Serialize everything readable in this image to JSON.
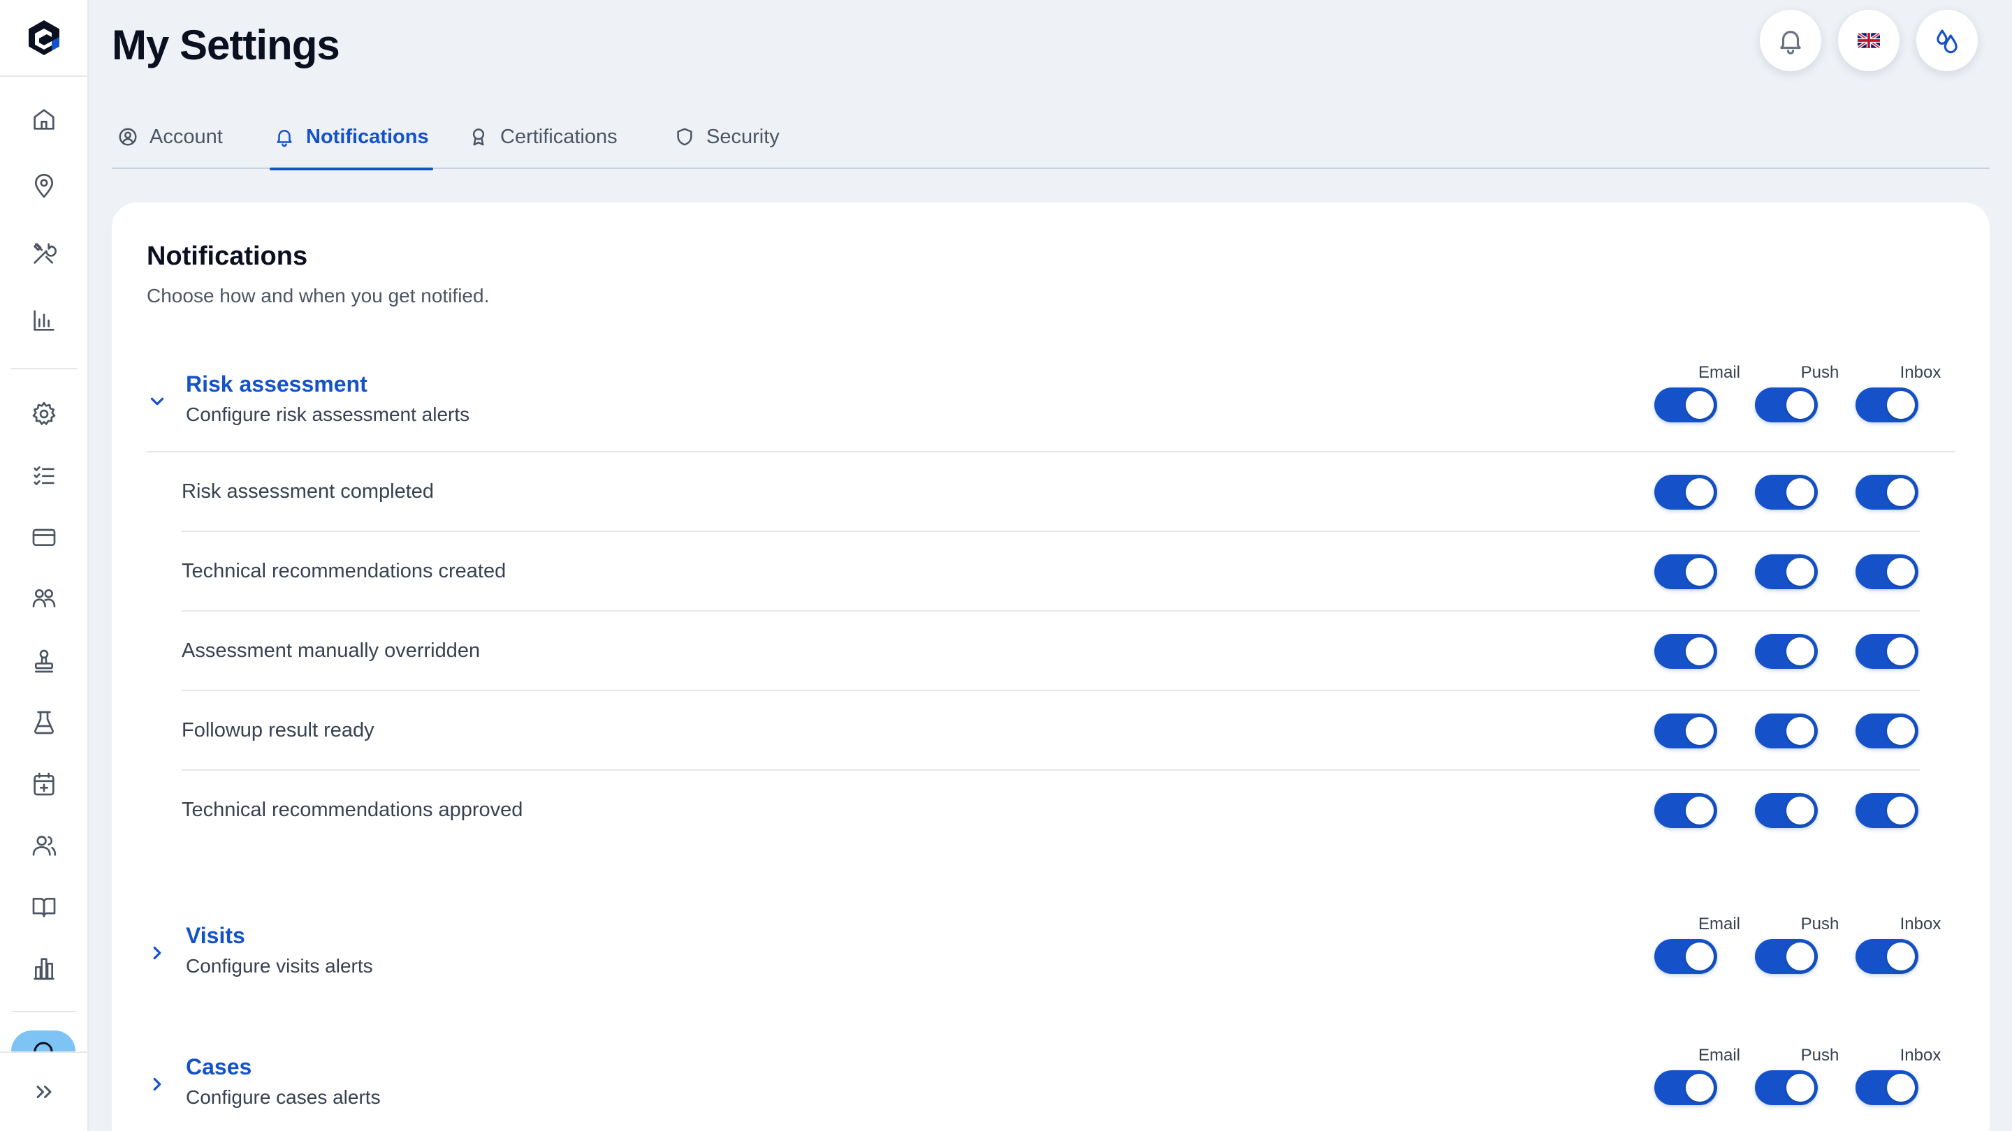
{
  "header": {
    "title": "My Settings"
  },
  "tabs": [
    {
      "label": "Account",
      "icon": "user-circle-icon",
      "active": false
    },
    {
      "label": "Notifications",
      "icon": "bell-icon",
      "active": true
    },
    {
      "label": "Certifications",
      "icon": "award-icon",
      "active": false
    },
    {
      "label": "Security",
      "icon": "shield-icon",
      "active": false
    }
  ],
  "sidebar": {
    "items": [
      "home-icon",
      "map-pin-icon",
      "tools-icon",
      "bar-chart-icon",
      "gear-icon",
      "checklist-icon",
      "credit-card-icon",
      "users-group-icon",
      "stamp-icon",
      "flask-icon",
      "calendar-plus-icon",
      "people-icon",
      "book-open-icon",
      "building-chart-icon"
    ],
    "expand_icon": "chevrons-right-icon"
  },
  "card": {
    "title": "Notifications",
    "subtitle": "Choose how and when you get notified."
  },
  "columns": [
    "Email",
    "Push",
    "Inbox"
  ],
  "groups": [
    {
      "title": "Risk assessment",
      "subtitle": "Configure risk assessment alerts",
      "expanded": true,
      "toggles": [
        true,
        true,
        true
      ],
      "items": [
        {
          "label": "Risk assessment completed",
          "toggles": [
            true,
            true,
            true
          ]
        },
        {
          "label": "Technical recommendations created",
          "toggles": [
            true,
            true,
            true
          ]
        },
        {
          "label": "Assessment manually overridden",
          "toggles": [
            true,
            true,
            true
          ]
        },
        {
          "label": "Followup result ready",
          "toggles": [
            true,
            true,
            true
          ]
        },
        {
          "label": "Technical recommendations approved",
          "toggles": [
            true,
            true,
            true
          ]
        }
      ]
    },
    {
      "title": "Visits",
      "subtitle": "Configure visits alerts",
      "expanded": false,
      "toggles": [
        true,
        true,
        true
      ]
    },
    {
      "title": "Cases",
      "subtitle": "Configure cases alerts",
      "expanded": false,
      "toggles": [
        true,
        true,
        true
      ]
    }
  ],
  "colors": {
    "accent": "#1552c9",
    "background": "#eef2f7",
    "card": "#ffffff"
  }
}
